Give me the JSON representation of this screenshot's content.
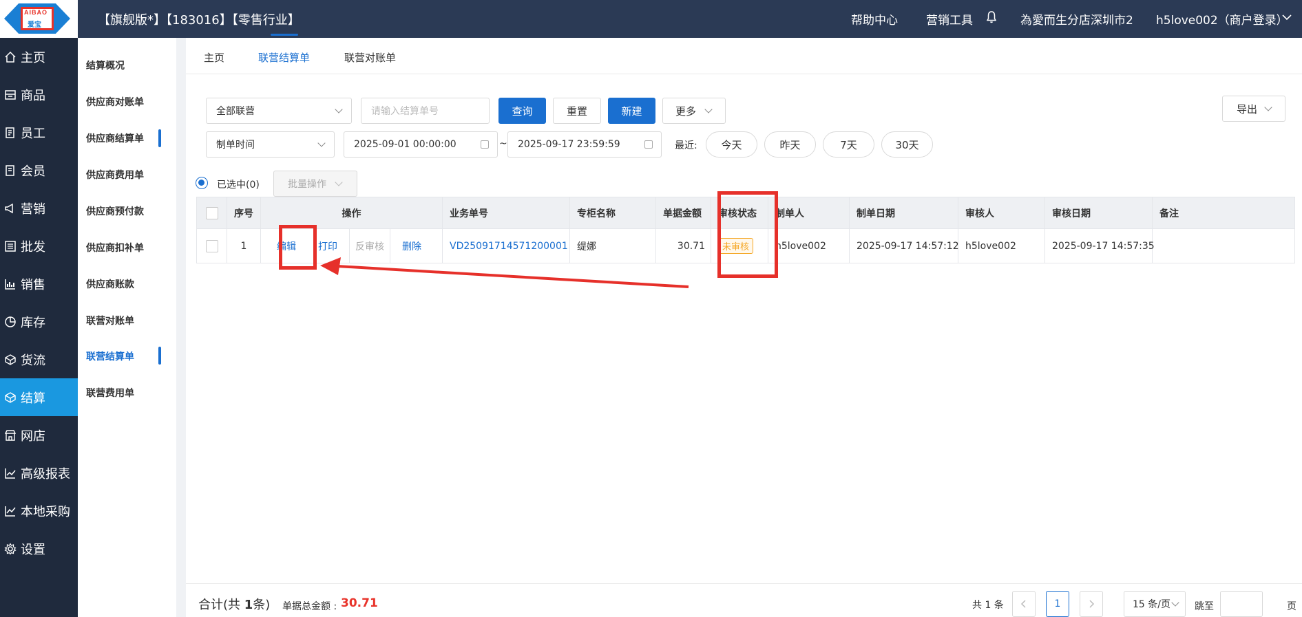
{
  "header": {
    "title": "【旗舰版*】【183016】【零售行业】",
    "help": "帮助中心",
    "marketing_tools": "营销工具",
    "store": "為愛而生分店深圳市2",
    "user": "h5love002（商户登录）",
    "logo_en": "AIBAO",
    "logo_cn": "爱宝"
  },
  "sidebar": {
    "items": [
      {
        "label": "主页",
        "icon": "home-icon"
      },
      {
        "label": "商品",
        "icon": "goods-icon"
      },
      {
        "label": "员工",
        "icon": "staff-icon"
      },
      {
        "label": "会员",
        "icon": "member-icon"
      },
      {
        "label": "营销",
        "icon": "megaphone-icon"
      },
      {
        "label": "批发",
        "icon": "wholesale-icon"
      },
      {
        "label": "销售",
        "icon": "chart-icon"
      },
      {
        "label": "库存",
        "icon": "pie-icon"
      },
      {
        "label": "货流",
        "icon": "box-icon"
      },
      {
        "label": "结算",
        "icon": "settle-icon"
      },
      {
        "label": "网店",
        "icon": "shop-icon"
      },
      {
        "label": "高级报表",
        "icon": "report-icon"
      },
      {
        "label": "本地采购",
        "icon": "purchase-icon"
      },
      {
        "label": "设置",
        "icon": "gear-icon"
      }
    ],
    "active": "结算"
  },
  "subnav": {
    "items": [
      "结算概况",
      "供应商对账单",
      "供应商结算单",
      "供应商费用单",
      "供应商预付款",
      "供应商扣补单",
      "供应商账款",
      "联营对账单",
      "联营结算单",
      "联营费用单"
    ],
    "active": "联营结算单"
  },
  "tabs": [
    "主页",
    "联营结算单",
    "联营对账单"
  ],
  "active_tab": "联营结算单",
  "filters": {
    "scope_select": "全部联营",
    "order_placeholder": "请输入结算单号",
    "query": "查询",
    "reset": "重置",
    "new": "新建",
    "more": "更多",
    "export": "导出",
    "date_type": "制单时间",
    "start": "2025-09-01 00:00:00",
    "end": "2025-09-17 23:59:59",
    "range_sep": "~",
    "recent_label": "最近:",
    "quick": [
      "今天",
      "昨天",
      "7天",
      "30天"
    ]
  },
  "selection": {
    "selected": "已选中(0)",
    "batch": "批量操作"
  },
  "table": {
    "headers": [
      "序号",
      "操作",
      "业务单号",
      "专柜名称",
      "单据金额",
      "审核状态",
      "制单人",
      "制单日期",
      "审核人",
      "审核日期",
      "备注"
    ],
    "rows": [
      {
        "no": "1",
        "actions": {
          "edit": "编辑",
          "print": "打印",
          "unaudit": "反审核",
          "delete": "删除"
        },
        "order_no": "VD25091714571200001",
        "counter": "缇娜",
        "amount": "30.71",
        "status": "未审核",
        "creator": "h5love002",
        "created": "2025-09-17 14:57:12",
        "auditor": "h5love002",
        "audited": "2025-09-17 14:57:35",
        "remark": ""
      }
    ]
  },
  "footer": {
    "total_prefix": "合计(共 ",
    "total_count": "1",
    "total_suffix": "条)",
    "amount_label": "单据总金额 :",
    "amount": "30.71",
    "pager_total": "共 1 条",
    "page": "1",
    "page_size": "15 条/页",
    "jump_label": "跳至",
    "page_unit": "页"
  },
  "colors": {
    "primary": "#1a6fd0",
    "sidebar_active": "#1a98e0",
    "annotation_red": "#e6302a",
    "status_pending": "#f5a623"
  }
}
